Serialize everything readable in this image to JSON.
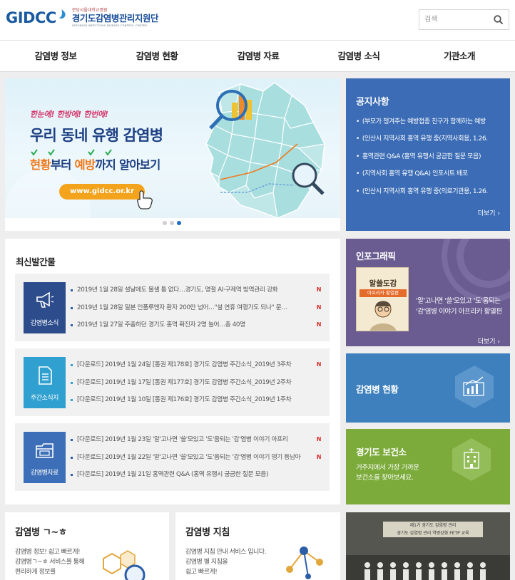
{
  "header": {
    "logo_text": "GIDCC",
    "org_sub": "분당서울대학교병원",
    "org_name": "경기도감염병관리지원단",
    "org_en": "GYEONGGI INFECTIOUS DISEASE CONTROL CENTER",
    "search_placeholder": "검색"
  },
  "nav": [
    {
      "label": "감염병 정보"
    },
    {
      "label": "감염병 현황"
    },
    {
      "label": "감염병 자료"
    },
    {
      "label": "감염병 소식"
    },
    {
      "label": "기관소개"
    }
  ],
  "banner": {
    "tagline": "한눈에! 한방에! 한번에!",
    "title": "우리 동네 유행 감염병",
    "subtitle_hl1": "현황",
    "subtitle_mid": "부터 ",
    "subtitle_hl2": "예방",
    "subtitle_end": "까지 알아보기",
    "url": "www.gidcc.or.kr",
    "slide_count": 3,
    "active_slide": 3
  },
  "notice": {
    "title": "공지사항",
    "items": [
      "(부모가 챙겨주는 예방접종 친구가 함께하는 예방",
      "(안산시 지역사회 홍역 유행 중(지역사회용, 1.26.",
      "홍역관련 Q&A (홍역 유행시 궁금한 질문 모음)",
      "(지역사회 홍역 유행 Q&A) 인포시트 배포",
      "(안산시 지역사회 홍역 유행 중(의료기관용, 1.26."
    ],
    "more": "더보기 ›"
  },
  "infographic": {
    "title": "인포그래픽",
    "thumb_title": "알쓸도감",
    "thumb_sub": "아프리카 황열편",
    "desc": "'알'고나면 '쓸'모있고 '도'움되는 '감'염병 이야기 아프리카 황열편",
    "more": "더보기 ›"
  },
  "status": {
    "title": "감염병 현황"
  },
  "health_center": {
    "title": "경기도 보건소",
    "desc_line1": "거주지에서 가장 가까운",
    "desc_line2": "보건소를 찾아보세요."
  },
  "photo": {
    "banner_line1": "제1기 경기도 감염병 관리",
    "banner_line2": "경기도 감염병 관리 역량강화 FETP 교육"
  },
  "publications": {
    "title": "최신발간물",
    "groups": [
      {
        "label": "감염병소식",
        "color": "#2c4c8c",
        "icon": "megaphone-icon",
        "items": [
          {
            "text": "2019년 1월 28일 설날에도 물샐 틈 없다…경기도, 명절 AI·구제역 방역관리 강화",
            "new": "N"
          },
          {
            "text": "2019년 1월 28일 일본 인플루엔자 환자 200만 넘어…\"설 연휴 여행가도 되나\" 문…",
            "new": "N"
          },
          {
            "text": "2019년 1월 27일 주춤하던 경기도 홍역 확진자 2명 늘어…총 40명",
            "new": "N"
          }
        ]
      },
      {
        "label": "주간소식지",
        "color": "#2fa0cf",
        "icon": "document-icon",
        "items": [
          {
            "text": "[다운로드] 2019년 1월 24일 [통권 제178호] 경기도 감염병 주간소식_2019년 3주차",
            "new": "N"
          },
          {
            "text": "[다운로드] 2019년 1월 17일 [통권 제177호] 경기도 감염병 주간소식_2019년 2주차",
            "new": ""
          },
          {
            "text": "[다운로드] 2019년 1월 10일 [통권 제176호] 경기도 감염병 주간소식_2019년 1주차",
            "new": ""
          }
        ]
      },
      {
        "label": "감염병자료",
        "color": "#3d6fb8",
        "icon": "folder-icon",
        "items": [
          {
            "text": "[다운로드] 2019년 1월 23일 '알'고나면 '쓸'모있고 '도'움되는 '감'염병 이야기 아프리",
            "new": "N"
          },
          {
            "text": "[다운로드] 2019년 1월 22일 '알'고나면 '쓸'모있고 '도'움되는 '감'염병 이야기 뎅기 등남아",
            "new": "N"
          },
          {
            "text": "[다운로드] 2019년 1월 21일 홍역관련 Q&A (홍역 유행시 궁금한 질문 모음)",
            "new": ""
          }
        ]
      }
    ]
  },
  "cards": [
    {
      "title": "감염병 ㄱ~ㅎ",
      "desc": [
        "감염병 정보! 쉽고 빠르게!",
        "감염병ㄱ~ㅎ 서비스를 통해",
        "편리하게 정보를"
      ]
    },
    {
      "title": "감염병 지침",
      "desc": [
        "감염병 지침 안내 서비스 입니다.",
        "감염병 별 지침을",
        "쉽고 빠르게!"
      ]
    }
  ]
}
